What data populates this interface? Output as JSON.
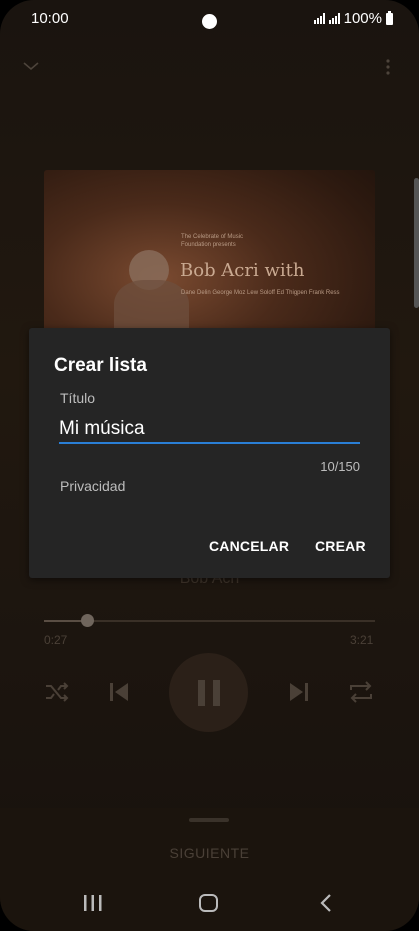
{
  "status_bar": {
    "time": "10:00",
    "battery": "100%"
  },
  "album": {
    "small_text": "The Celebrate of Music Foundation presents",
    "title": "Bob Acri with",
    "names": "Dane Delin George Moz Lew Soloff Ed Thigpen Frank Ress"
  },
  "player": {
    "artist": "Bob Acri",
    "current_time": "0:27",
    "total_time": "3:21",
    "progress_fraction": 0.13
  },
  "dialog": {
    "title": "Crear lista",
    "field_label": "Título",
    "field_value": "Mi música",
    "counter": "10/150",
    "privacy_label": "Privacidad",
    "cancel_label": "CANCELAR",
    "create_label": "CREAR"
  },
  "next_panel": {
    "label": "SIGUIENTE"
  },
  "colors": {
    "accent": "#2a7fd6",
    "dialog_bg": "#252525"
  }
}
